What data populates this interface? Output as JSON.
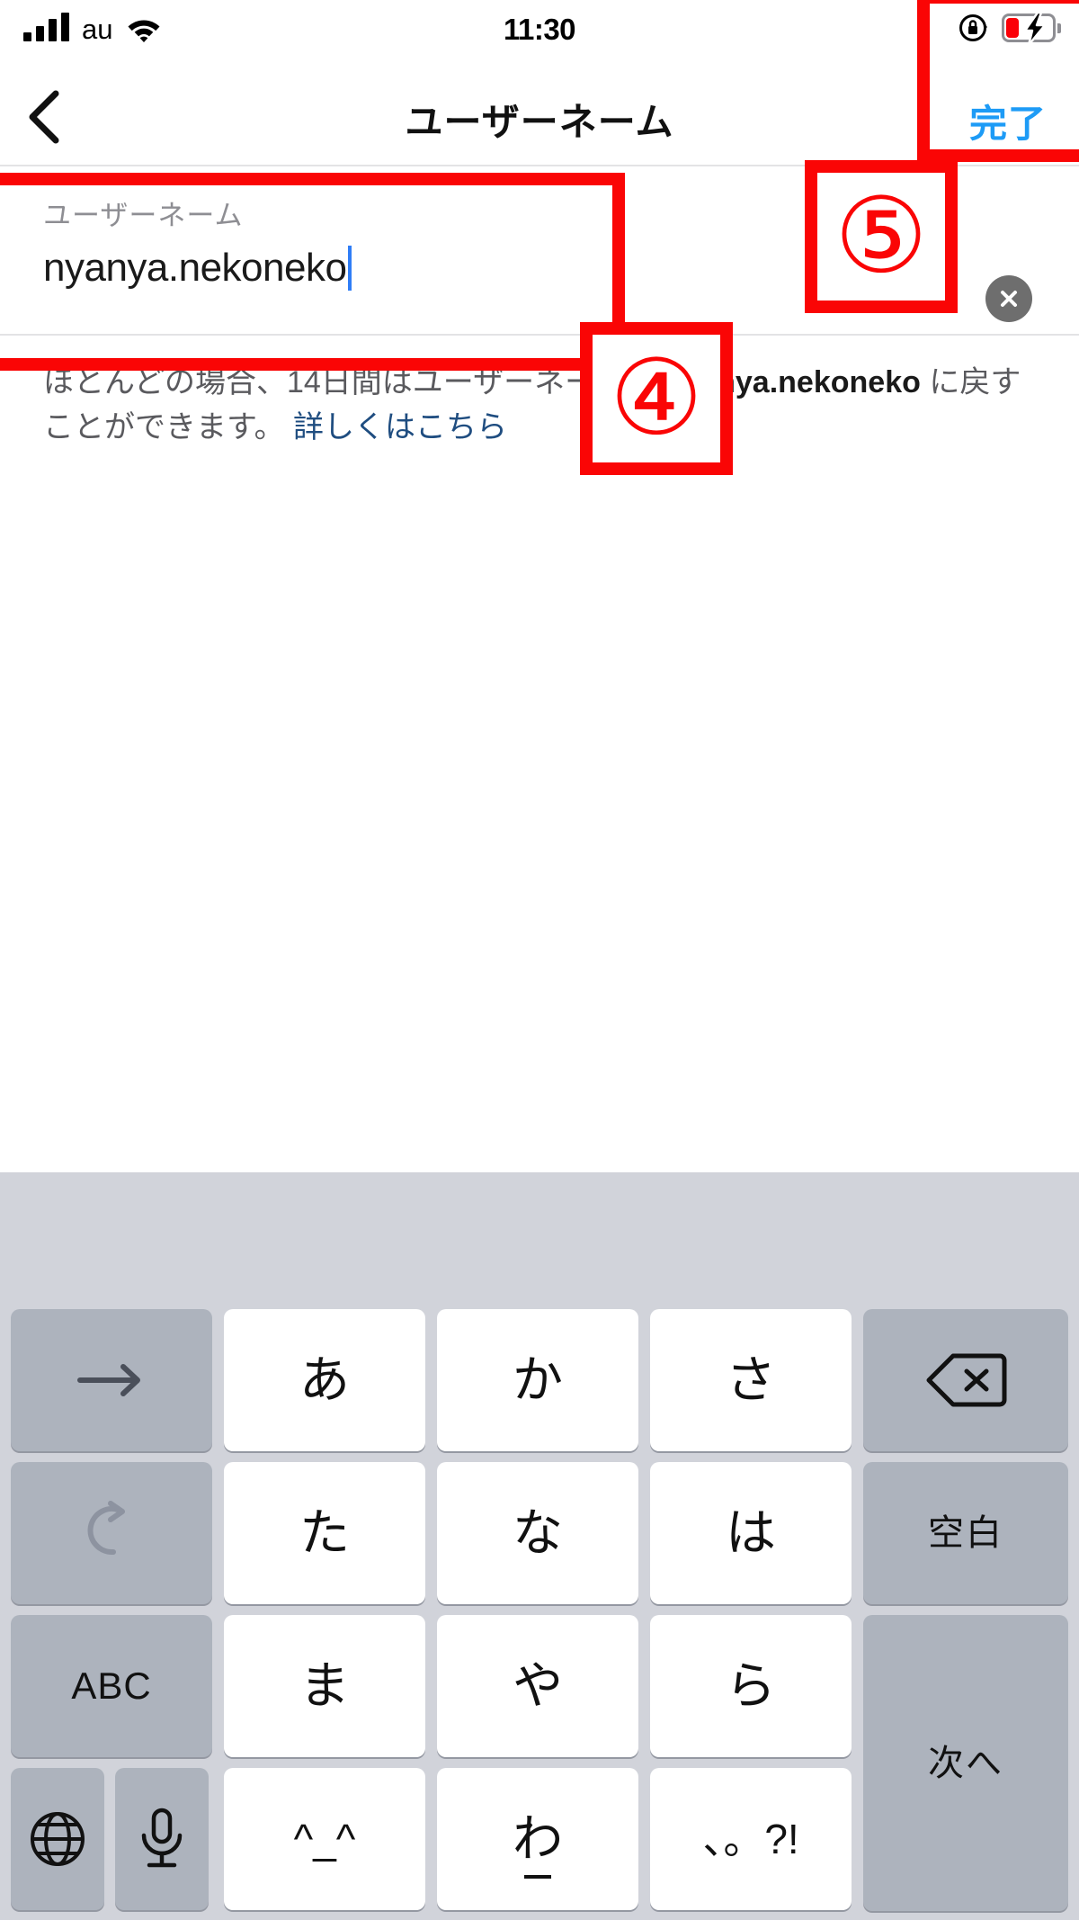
{
  "status_bar": {
    "carrier": "au",
    "time": "11:30",
    "signal_icon": "signal-bars-icon",
    "wifi_icon": "wifi-icon",
    "rotation_lock_icon": "rotation-lock-icon",
    "battery_icon": "battery-charging-low-icon"
  },
  "nav_bar": {
    "back_icon": "chevron-left-icon",
    "title": "ユーザーネーム",
    "done_label": "完了",
    "done_color": "#1d9bf6"
  },
  "field": {
    "label": "ユーザーネーム",
    "value": "nyanya.nekoneko",
    "placeholder": "ユーザーネーム",
    "clear_icon": "clear-circle-x-icon",
    "caret_color": "#2f7df6"
  },
  "description": {
    "part1": "ほとんどの場合、14日間はユーザーネームを ",
    "username": "nyanya.nekoneko",
    "part2": " に戻すことができます。 ",
    "link": "詳しくはこちら",
    "link_color": "#1f4d80"
  },
  "annotations": {
    "color": "#fa0505",
    "marker_4": "④",
    "marker_5": "⑤"
  },
  "keyboard": {
    "background": "#d1d3da",
    "keys": [
      {
        "name": "key-arrow-right",
        "label": "→",
        "type": "icon-arrow",
        "style": "dark"
      },
      {
        "name": "key-a-row",
        "label": "あ",
        "style": "light"
      },
      {
        "name": "key-ka-row",
        "label": "か",
        "style": "light"
      },
      {
        "name": "key-sa-row",
        "label": "さ",
        "style": "light"
      },
      {
        "name": "key-backspace",
        "label": "⌫",
        "type": "icon-backspace",
        "style": "dark"
      },
      {
        "name": "key-undo",
        "label": "↺",
        "type": "icon-undo",
        "style": "dark"
      },
      {
        "name": "key-ta-row",
        "label": "た",
        "style": "light"
      },
      {
        "name": "key-na-row",
        "label": "な",
        "style": "light"
      },
      {
        "name": "key-ha-row",
        "label": "は",
        "style": "light"
      },
      {
        "name": "key-space",
        "label": "空白",
        "style": "dark"
      },
      {
        "name": "key-abc",
        "label": "ABC",
        "style": "dark"
      },
      {
        "name": "key-ma-row",
        "label": "ま",
        "style": "light"
      },
      {
        "name": "key-ya-row",
        "label": "や",
        "style": "light"
      },
      {
        "name": "key-ra-row",
        "label": "ら",
        "style": "light"
      },
      {
        "name": "key-next",
        "label": "次へ",
        "style": "dark"
      },
      {
        "name": "key-globe",
        "label": "🌐",
        "type": "icon-globe",
        "style": "dark"
      },
      {
        "name": "key-microphone",
        "label": "🎤",
        "type": "icon-mic",
        "style": "dark"
      },
      {
        "name": "key-emoticon",
        "label": "^_^",
        "style": "light"
      },
      {
        "name": "key-wa-row",
        "label": "わ",
        "style": "light"
      },
      {
        "name": "key-punctuation",
        "label": "、。?!",
        "style": "light"
      }
    ]
  }
}
